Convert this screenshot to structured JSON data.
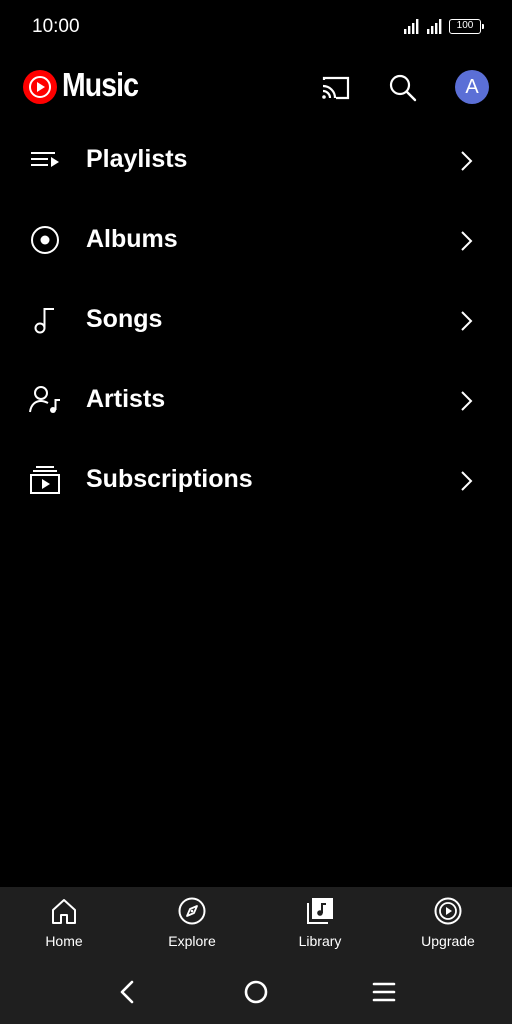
{
  "status_bar": {
    "time": "10:00",
    "battery": "100"
  },
  "header": {
    "app_name": "Music",
    "avatar_initial": "A",
    "icons": [
      "youtube-music-logo-icon",
      "cast-icon",
      "search-icon"
    ]
  },
  "library": {
    "items": [
      {
        "label": "Playlists",
        "icon": "playlist-icon"
      },
      {
        "label": "Albums",
        "icon": "album-icon"
      },
      {
        "label": "Songs",
        "icon": "music-note-icon"
      },
      {
        "label": "Artists",
        "icon": "artist-icon"
      },
      {
        "label": "Subscriptions",
        "icon": "subscriptions-icon"
      }
    ]
  },
  "bottom_nav": {
    "items": [
      {
        "label": "Home",
        "icon": "home-icon"
      },
      {
        "label": "Explore",
        "icon": "compass-icon"
      },
      {
        "label": "Library",
        "icon": "library-icon",
        "active": true
      },
      {
        "label": "Upgrade",
        "icon": "upgrade-icon"
      }
    ]
  },
  "colors": {
    "background": "#000000",
    "nav_background": "#1f1f1f",
    "brand_red": "#ff0000",
    "avatar": "#5b6fd6"
  }
}
